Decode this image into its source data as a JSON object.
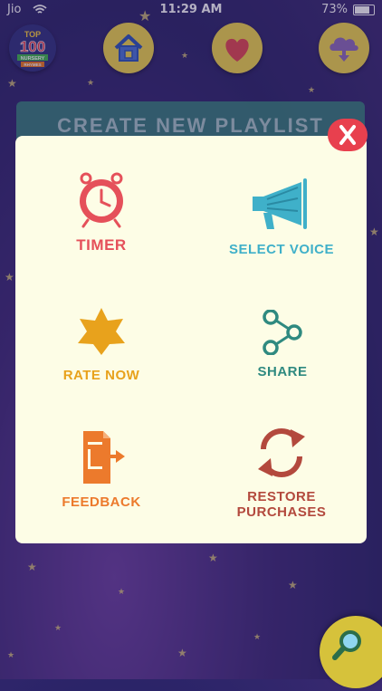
{
  "status": {
    "carrier": "Jio",
    "time": "11:29 AM",
    "battery": "73%",
    "battery_level": 0.73
  },
  "header": {
    "logo": {
      "line1": "TOP",
      "line2": "100",
      "line3": "NURSERY",
      "line4": "RHYMES"
    }
  },
  "background": {
    "playlist_label": "CREATE NEW PLAYLIST"
  },
  "menu": {
    "timer": "TIMER",
    "select_voice": "SELECT VOICE",
    "rate_now": "RATE NOW",
    "share": "SHARE",
    "feedback": "FEEDBACK",
    "restore_line1": "RESTORE",
    "restore_line2": "PURCHASES"
  },
  "colors": {
    "timer": "#e5505a",
    "voice": "#3fb0c9",
    "rate": "#e8a21c",
    "share": "#2f8a80",
    "feedback": "#ec7a2c",
    "restore": "#b3493d",
    "close": "#e8404e",
    "yellow_button": "#f2d64b"
  },
  "icons": {
    "home": "home-icon",
    "heart": "heart-icon",
    "download": "cloud-download-icon",
    "timer": "alarm-clock-icon",
    "voice": "megaphone-icon",
    "rate": "star-icon",
    "share": "share-icon",
    "feedback": "feedback-form-icon",
    "restore": "refresh-icon",
    "search": "search-icon",
    "close": "close-icon"
  }
}
